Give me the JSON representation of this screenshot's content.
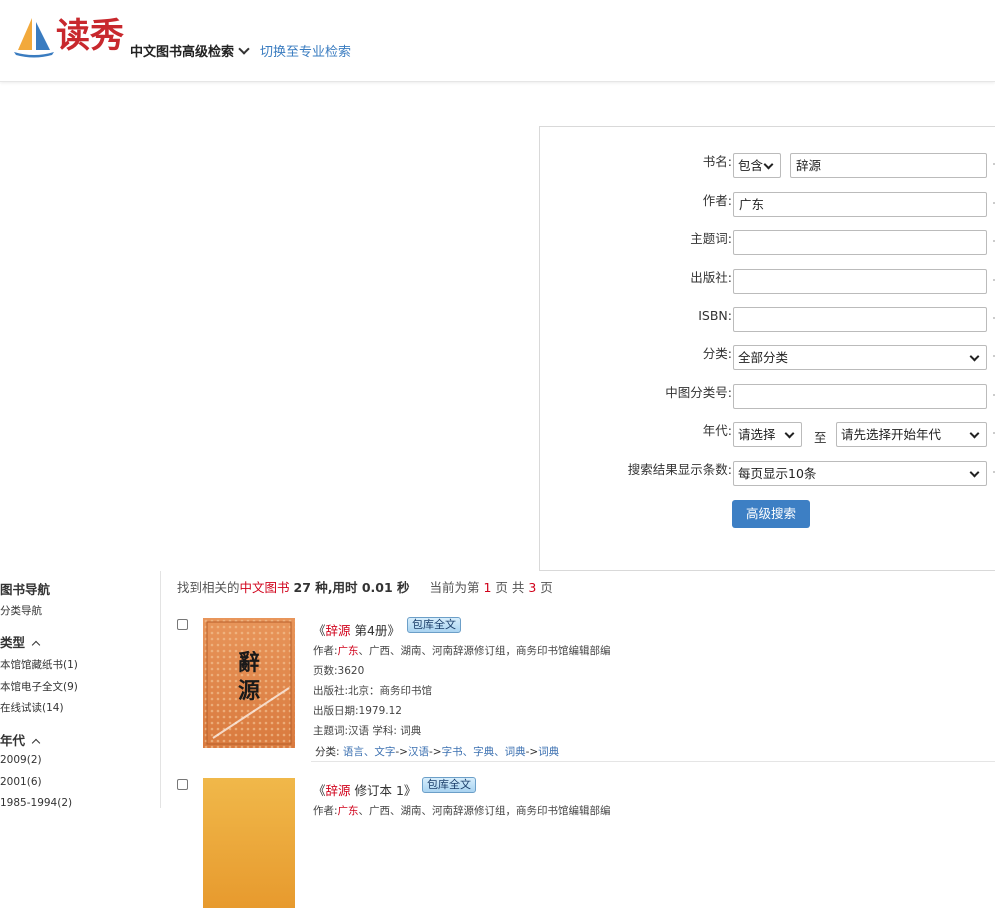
{
  "header": {
    "logo_text": "读秀",
    "nav_title": "中文图书高级检索",
    "switch_link": "切换至专业检索"
  },
  "form": {
    "title_label": "书名:",
    "title_mode": "包含",
    "title_value": "辞源",
    "author_label": "作者:",
    "author_value": "广东",
    "subject_label": "主题词:",
    "subject_value": "",
    "publisher_label": "出版社:",
    "publisher_value": "",
    "isbn_label": "ISBN:",
    "isbn_value": "",
    "category_label": "分类:",
    "category_value": "全部分类",
    "clc_label": "中图分类号:",
    "clc_value": "",
    "year_label": "年代:",
    "year_from": "请选择",
    "year_to_label": "至",
    "year_to": "请先选择开始年代",
    "per_page_label": "搜索结果显示条数:",
    "per_page_value": "每页显示10条",
    "submit_label": "高级搜索"
  },
  "sidebar": {
    "nav_title": "图书导航",
    "nav_item": "分类导航",
    "type_title": "类型",
    "type_items": [
      "本馆馆藏纸书(1)",
      "本馆电子全文(9)",
      "在线试读(14)"
    ],
    "year_title": "年代",
    "year_items": [
      "2009(2)",
      "2001(6)",
      "1985-1994(2)"
    ]
  },
  "summary": {
    "prefix": "找到相关的",
    "kind": "中文图书",
    "count_text": "27 种,用时 0.01 秒",
    "page_prefix": "当前为第",
    "current_page": "1",
    "page_mid": "页 共",
    "total_pages": "3",
    "page_suffix": "页"
  },
  "results": [
    {
      "title_open": "《",
      "title_highlight": "辞源",
      "title_rest": " 第4册》",
      "badge": "包库全文",
      "author_prefix": "作者:",
      "author_highlight": "广东",
      "author_rest": "、广西、湖南、河南辞源修订组，商务印书馆编辑部编",
      "pages": "页数:3620",
      "publisher": "出版社:北京：商务印书馆",
      "date": "出版日期:1979.12",
      "subject": "主题词:汉语 学科: 词典",
      "category_prefix": "分类:",
      "category_links": [
        "语言、文字",
        "汉语",
        "字书、字典、词典",
        "词典"
      ],
      "cover_color_top": "#e8955a",
      "cover_color_bottom": "#d97a3e"
    },
    {
      "title_open": "《",
      "title_highlight": "辞源",
      "title_rest": " 修订本 1》",
      "badge": "包库全文",
      "author_prefix": "作者:",
      "author_highlight": "广东",
      "author_rest": "、广西、湖南、河南辞源修订组，商务印书馆编辑部编",
      "cover_color_top": "#f0b84a",
      "cover_color_bottom": "#e79a2e"
    }
  ],
  "cover_text": "辭源",
  "colors": {
    "accent": "#3d7fc4",
    "highlight": "#d0021b",
    "brand": "#c8282d"
  }
}
